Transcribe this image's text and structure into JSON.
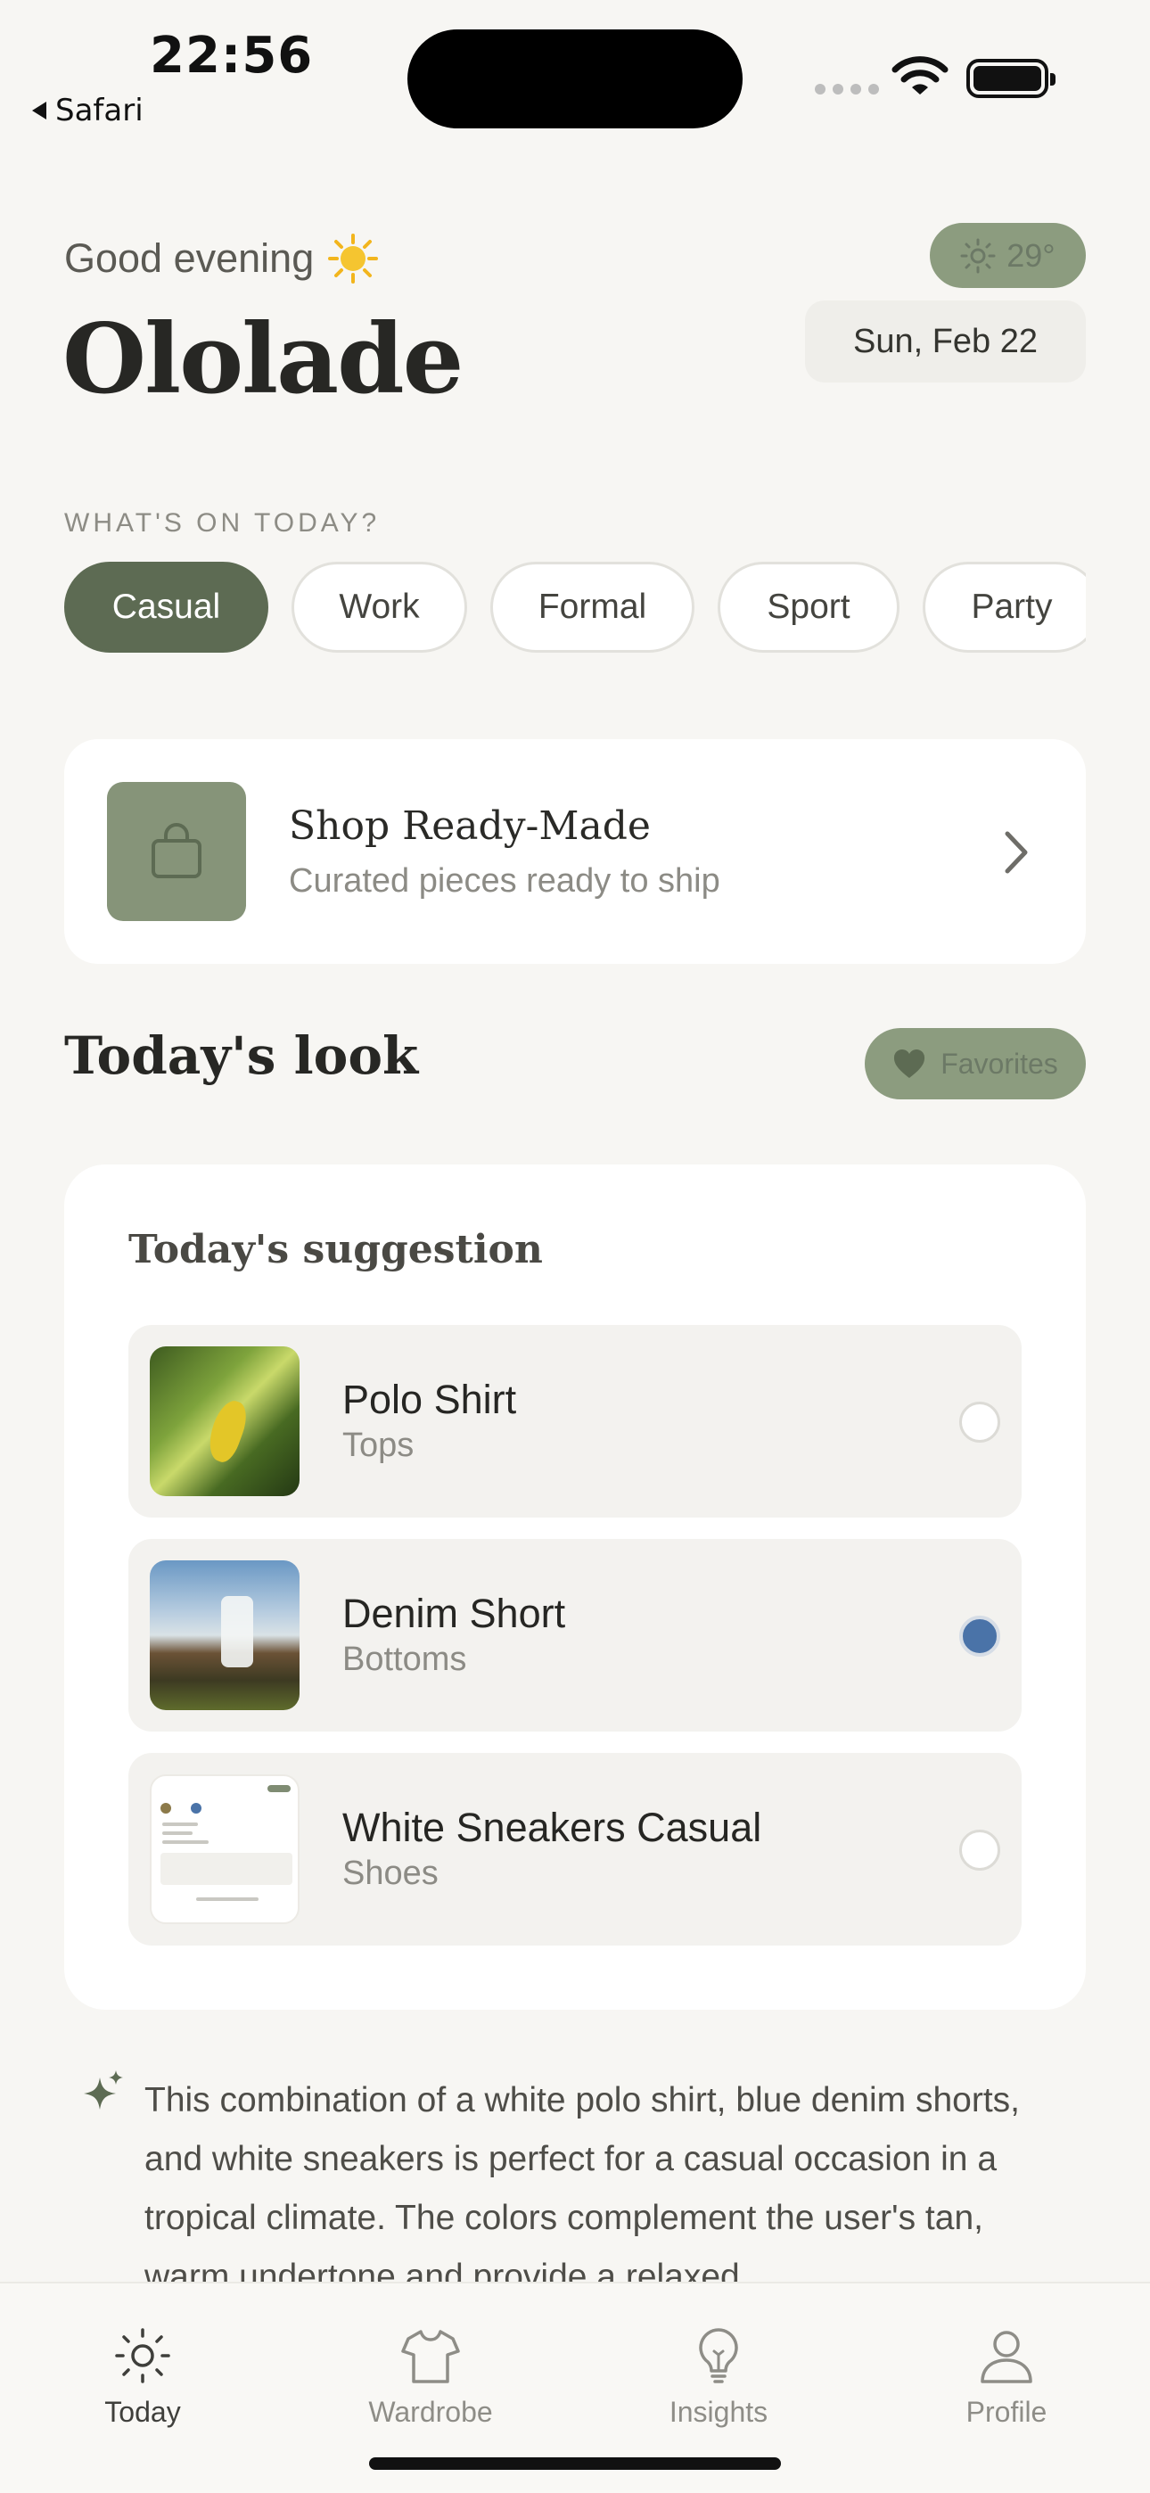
{
  "status_bar": {
    "time": "22:56",
    "back_app": "Safari"
  },
  "header": {
    "greeting": "Good evening",
    "greeting_icon": "sun-emoji",
    "user_name": "Ololade",
    "weather": {
      "icon": "sun-icon",
      "temperature": "29°"
    },
    "date": "Sun, Feb 22"
  },
  "occasion": {
    "label": "WHAT'S ON TODAY?",
    "chips": [
      {
        "label": "Casual",
        "selected": true
      },
      {
        "label": "Work",
        "selected": false
      },
      {
        "label": "Formal",
        "selected": false
      },
      {
        "label": "Sport",
        "selected": false
      },
      {
        "label": "Party",
        "selected": false
      }
    ]
  },
  "shop": {
    "title": "Shop Ready-Made",
    "subtitle": "Curated pieces ready to ship",
    "icon": "shopping-bag-icon"
  },
  "look": {
    "title": "Today's look",
    "favorites_label": "Favorites",
    "card_title": "Today's suggestion",
    "items": [
      {
        "name": "Polo Shirt",
        "category": "Tops",
        "selected": false,
        "image": "leaf-photo"
      },
      {
        "name": "Denim Short",
        "category": "Bottoms",
        "selected": true,
        "image": "waterfall-photo"
      },
      {
        "name": "White Sneakers Casual",
        "category": "Shoes",
        "selected": false,
        "image": "screenshot-thumbnail"
      }
    ]
  },
  "description": "This combination of a white polo shirt, blue denim shorts, and white sneakers is perfect for a casual occasion in a tropical climate. The colors complement the user's tan, warm undertone and provide a relaxed",
  "tabs": [
    {
      "label": "Today",
      "icon": "sun-icon",
      "active": true
    },
    {
      "label": "Wardrobe",
      "icon": "tshirt-icon",
      "active": false
    },
    {
      "label": "Insights",
      "icon": "lightbulb-icon",
      "active": false
    },
    {
      "label": "Profile",
      "icon": "person-icon",
      "active": false
    }
  ],
  "colors": {
    "accent": "#5d6b53",
    "accent_light": "#8c9c7f",
    "background": "#f7f6f3",
    "selected_radio": "#4a73a8"
  }
}
